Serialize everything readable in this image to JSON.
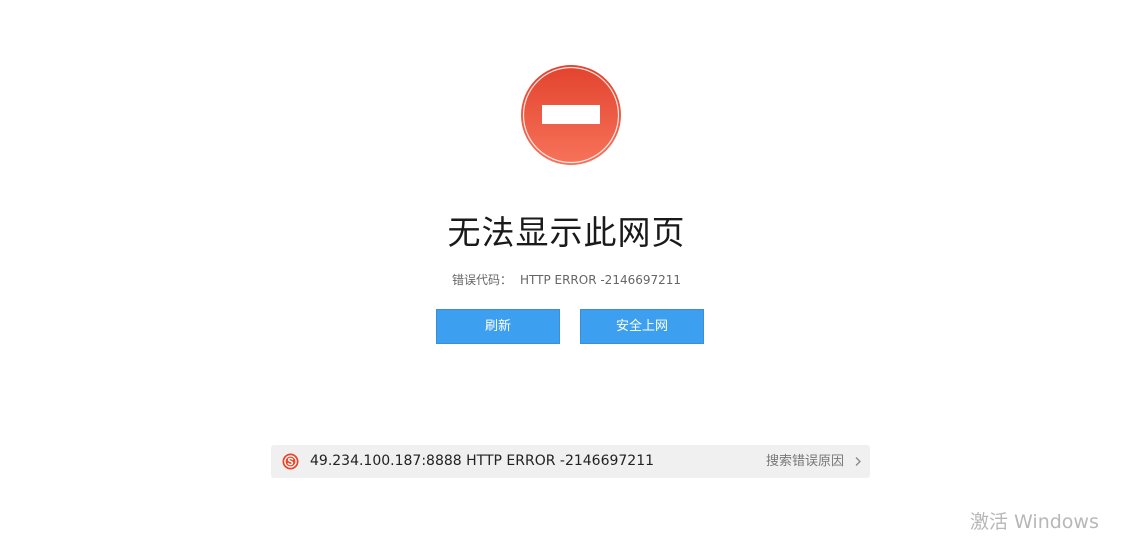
{
  "error": {
    "title": "无法显示此网页",
    "code_label": "错误代码：",
    "code_value": "HTTP ERROR -2146697211"
  },
  "buttons": {
    "refresh_label": "刷新",
    "safe_browse_label": "安全上网"
  },
  "search_bar": {
    "text": "49.234.100.187:8888 HTTP ERROR -2146697211",
    "link_label": "搜索错误原因",
    "icon": "sogou-icon"
  },
  "watermark": {
    "text": "激活 Windows"
  },
  "colors": {
    "button_blue": "#3d9ff0",
    "icon_red_top": "#e2432e",
    "icon_red_bottom": "#f7735a",
    "bar_background": "#f0f0f0"
  }
}
